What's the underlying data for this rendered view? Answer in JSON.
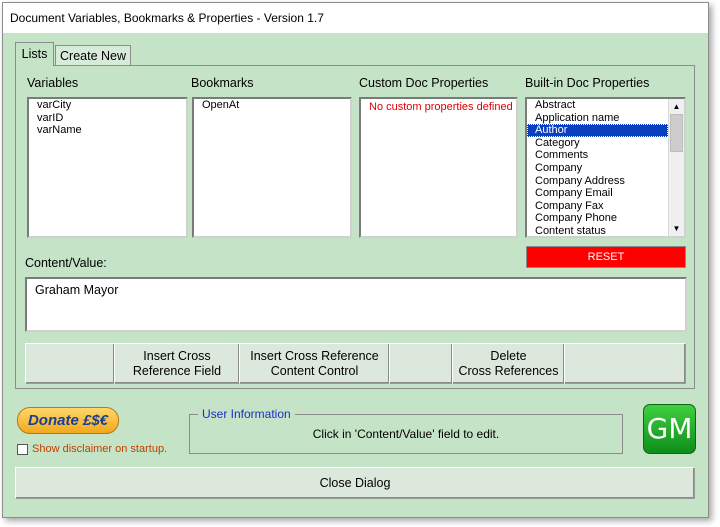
{
  "window": {
    "title": "Document Variables, Bookmarks & Properties - Version 1.7"
  },
  "tabs": [
    {
      "label": "Lists"
    },
    {
      "label": "Create New"
    }
  ],
  "lists": {
    "variables": {
      "label": "Variables",
      "items": [
        "varCity",
        "varID",
        "varName"
      ]
    },
    "bookmarks": {
      "label": "Bookmarks",
      "items": [
        "OpenAt"
      ]
    },
    "custom": {
      "label": "Custom Doc Properties",
      "message": "No custom properties defined"
    },
    "builtin": {
      "label": "Built-in Doc Properties",
      "items": [
        "Abstract",
        "Application name",
        "Author",
        "Category",
        "Comments",
        "Company",
        "Company Address",
        "Company Email",
        "Company Fax",
        "Company Phone",
        "Content status"
      ],
      "selected": "Author"
    }
  },
  "reset_label": "RESET",
  "content": {
    "label": "Content/Value:",
    "value": "Graham Mayor"
  },
  "buttons": {
    "insert_field": "Insert Cross\nReference Field",
    "insert_cc": "Insert Cross Reference\nContent Control",
    "delete_refs": "Delete\nCross References"
  },
  "donate_label": "Donate £$€",
  "disclaimer": "Show disclaimer on startup.",
  "user_info": {
    "legend": "User Information",
    "message": "Click in 'Content/Value' field to edit."
  },
  "logo_text": "GM",
  "close_label": "Close Dialog",
  "colors": {
    "background": "#c5e3c6",
    "reset": "#ff0000",
    "selection": "#0a3fbf",
    "legend": "#1a30c0"
  }
}
